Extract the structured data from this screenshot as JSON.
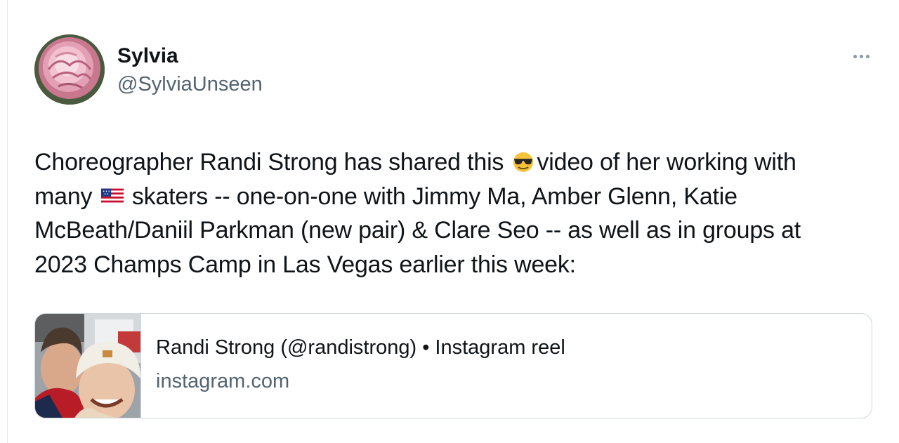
{
  "author": {
    "display_name": "Sylvia",
    "handle": "@SylviaUnseen"
  },
  "tweet": {
    "line1_a": "Choreographer Randi Strong has shared this ",
    "line1_emoji": "sunglasses-face-emoji",
    "line1_b": "video of her working with",
    "line2_a": "many ",
    "line2_emoji": "us-flag-emoji",
    "line2_b": " skaters -- one-on-one with Jimmy Ma, Amber Glenn, Katie",
    "line3": "McBeath/Daniil Parkman (new pair) & Clare Seo -- as well as in groups at",
    "line4": "2023 Champs Camp in Las Vegas earlier this week:"
  },
  "link_card": {
    "title": "Randi Strong (@randistrong) • Instagram reel",
    "domain": "instagram.com"
  },
  "icons": {
    "more": "more-horizontal-icon"
  },
  "colors": {
    "text_primary": "#0f1419",
    "text_secondary": "#536471",
    "border": "#cfd9de"
  }
}
